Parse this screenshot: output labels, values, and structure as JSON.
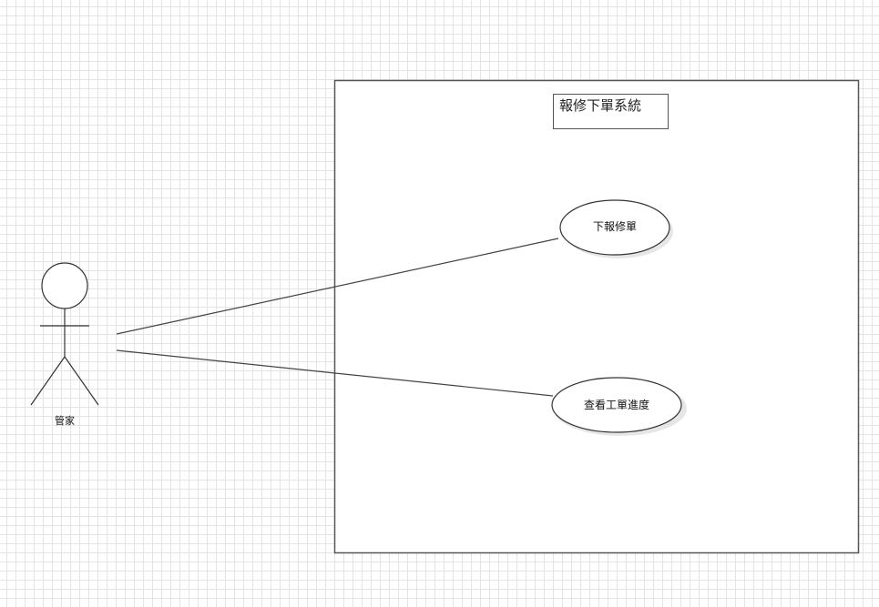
{
  "system": {
    "title": "報修下單系統"
  },
  "actor": {
    "name": "管家"
  },
  "use_cases": [
    {
      "label": "下報修單"
    },
    {
      "label": "查看工單進度"
    }
  ],
  "colors": {
    "line": "#444444",
    "grid": "#e4e4e4",
    "shadow": "#e6e6e6"
  }
}
